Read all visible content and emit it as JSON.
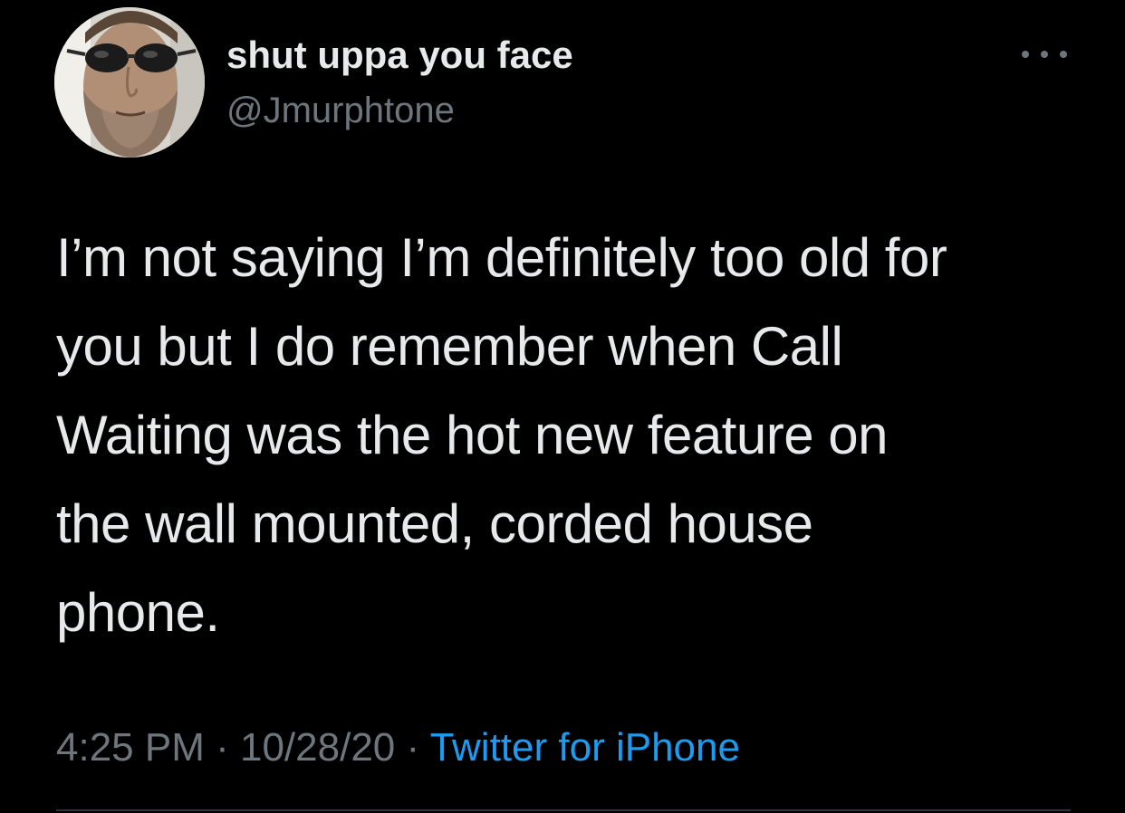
{
  "author": {
    "display_name": "shut uppa you face",
    "handle": "@Jmurphtone"
  },
  "icons": {
    "more": "more-horizontal-icon",
    "avatar": "profile-photo-man-sunglasses-beard"
  },
  "tweet": {
    "lines": [
      "I’m not saying I’m definitely too old for",
      "you but I do remember when Call",
      "Waiting was the hot new feature on",
      "the wall mounted, corded house",
      "phone."
    ]
  },
  "meta": {
    "time": "4:25 PM",
    "separator1": " · ",
    "date": "10/28/20",
    "separator2": " · ",
    "source": "Twitter for iPhone"
  },
  "colors": {
    "background": "#000000",
    "text": "#e7e9ea",
    "secondary": "#6e767d",
    "link": "#1d9bf0",
    "divider": "#2f3336"
  }
}
